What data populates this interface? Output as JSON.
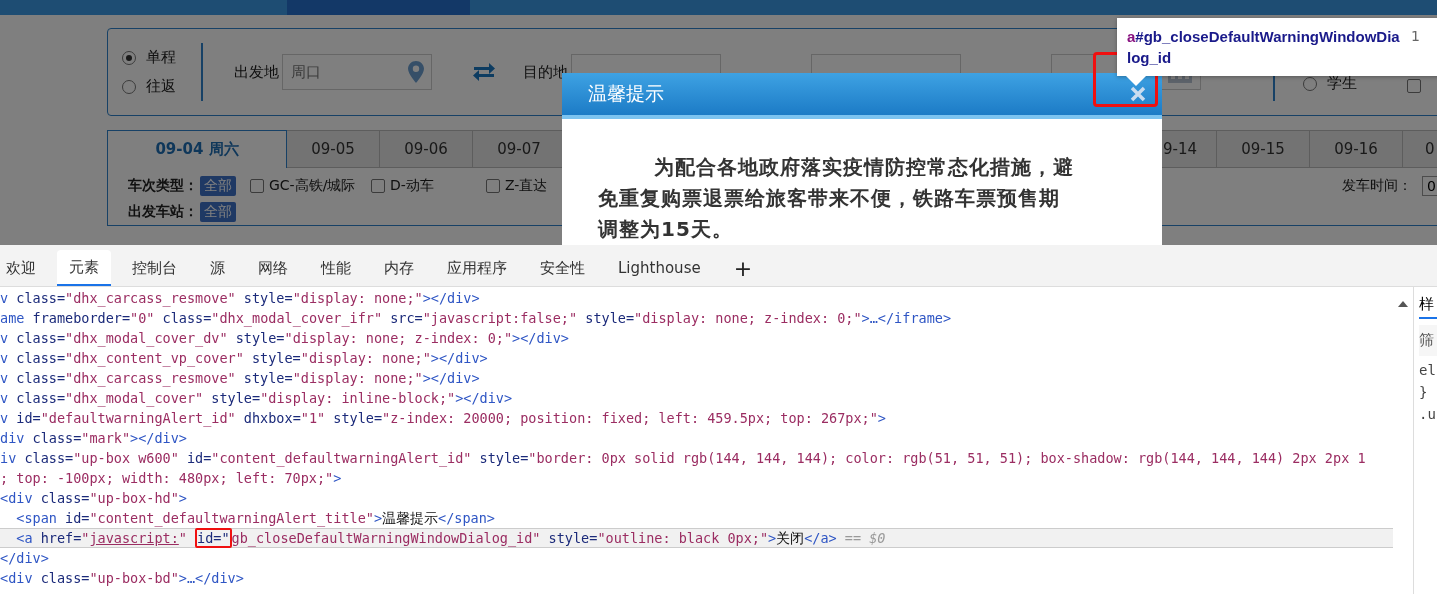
{
  "search": {
    "trip_types": [
      {
        "label": "单程",
        "selected": true
      },
      {
        "label": "往返",
        "selected": false
      }
    ],
    "fields": [
      {
        "label": "出发地",
        "value": "周口",
        "kind": "location"
      },
      {
        "label": "目的地"
      },
      {
        "kind": "plain"
      },
      {
        "kind": "date"
      }
    ],
    "passenger": {
      "label": "学生",
      "selected": false
    },
    "extra_option": {
      "checked": false
    }
  },
  "date_tabs": [
    {
      "label": "09-04 周六",
      "selected": true
    },
    {
      "label": "09-05",
      "selected": false
    },
    {
      "label": "09-06",
      "selected": false
    },
    {
      "label": "09-07",
      "selected": false
    }
  ],
  "date_tabs_right": [
    {
      "label": "9-14",
      "selected": false
    },
    {
      "label": "09-15",
      "selected": false
    },
    {
      "label": "09-16",
      "selected": false
    },
    {
      "label": "0",
      "selected": false
    }
  ],
  "filters": {
    "train_type": {
      "label": "车次类型：",
      "badge": "全部",
      "options": [
        {
          "label": "GC-高铁/城际",
          "checked": false
        },
        {
          "label": "D-动车",
          "checked": false
        },
        {
          "label": "Z-直达",
          "checked": false
        }
      ]
    },
    "station": {
      "label": "出发车站：",
      "badge": "全部"
    },
    "departure_time": {
      "label": "发车时间：",
      "value": "0"
    }
  },
  "dialog": {
    "title": "温馨提示",
    "message": "为配合各地政府落实疫情防控常态化措施，避免重复购票退票给旅客带来不便，铁路车票预售期调整为15天。"
  },
  "tooltip": {
    "tag": "a",
    "selector": "#gb_closeDefaultWarningWindowDialog_id",
    "dimension": "1"
  },
  "devtools": {
    "tabs": [
      {
        "label": "欢迎",
        "selected": false
      },
      {
        "label": "元素",
        "selected": true
      },
      {
        "label": "控制台",
        "selected": false
      },
      {
        "label": "源",
        "selected": false
      },
      {
        "label": "网络",
        "selected": false
      },
      {
        "label": "性能",
        "selected": false
      },
      {
        "label": "内存",
        "selected": false
      },
      {
        "label": "应用程序",
        "selected": false
      },
      {
        "label": "安全性",
        "selected": false
      },
      {
        "label": "Lighthouse",
        "selected": false
      }
    ],
    "add_tab": "+",
    "lines": [
      {
        "selected": false,
        "segments": [
          {
            "kind": "tag",
            "text": "v "
          },
          {
            "kind": "attr",
            "text": "class="
          },
          {
            "kind": "value",
            "text": "\"dhx_carcass_resmove\" "
          },
          {
            "kind": "attr",
            "text": "style="
          },
          {
            "kind": "value",
            "text": "\"display: none;\""
          },
          {
            "kind": "tag",
            "text": "></div>"
          }
        ]
      },
      {
        "selected": false,
        "segments": [
          {
            "kind": "tag",
            "text": "ame "
          },
          {
            "kind": "attr",
            "text": "frameborder="
          },
          {
            "kind": "value",
            "text": "\"0\" "
          },
          {
            "kind": "attr",
            "text": "class="
          },
          {
            "kind": "value",
            "text": "\"dhx_modal_cover_ifr\" "
          },
          {
            "kind": "attr",
            "text": "src="
          },
          {
            "kind": "value",
            "text": "\"javascript:false;\" "
          },
          {
            "kind": "attr",
            "text": "style="
          },
          {
            "kind": "value",
            "text": "\"display: none; z-index: 0;\""
          },
          {
            "kind": "tag",
            "text": ">…</iframe>"
          }
        ]
      },
      {
        "selected": false,
        "segments": [
          {
            "kind": "tag",
            "text": "v "
          },
          {
            "kind": "attr",
            "text": "class="
          },
          {
            "kind": "value",
            "text": "\"dhx_modal_cover_dv\" "
          },
          {
            "kind": "attr",
            "text": "style="
          },
          {
            "kind": "value",
            "text": "\"display: none; z-index: 0;\""
          },
          {
            "kind": "tag",
            "text": "></div>"
          }
        ]
      },
      {
        "selected": false,
        "segments": [
          {
            "kind": "tag",
            "text": "v "
          },
          {
            "kind": "attr",
            "text": "class="
          },
          {
            "kind": "value",
            "text": "\"dhx_content_vp_cover\" "
          },
          {
            "kind": "attr",
            "text": "style="
          },
          {
            "kind": "value",
            "text": "\"display: none;\""
          },
          {
            "kind": "tag",
            "text": "></div>"
          }
        ]
      },
      {
        "selected": false,
        "segments": [
          {
            "kind": "tag",
            "text": "v "
          },
          {
            "kind": "attr",
            "text": "class="
          },
          {
            "kind": "value",
            "text": "\"dhx_carcass_resmove\" "
          },
          {
            "kind": "attr",
            "text": "style="
          },
          {
            "kind": "value",
            "text": "\"display: none;\""
          },
          {
            "kind": "tag",
            "text": "></div>"
          }
        ]
      },
      {
        "selected": false,
        "segments": [
          {
            "kind": "tag",
            "text": "v "
          },
          {
            "kind": "attr",
            "text": "class="
          },
          {
            "kind": "value",
            "text": "\"dhx_modal_cover\" "
          },
          {
            "kind": "attr",
            "text": "style="
          },
          {
            "kind": "value",
            "text": "\"display: inline-block;\""
          },
          {
            "kind": "tag",
            "text": "></div>"
          }
        ]
      },
      {
        "selected": false,
        "segments": [
          {
            "kind": "tag",
            "text": "v "
          },
          {
            "kind": "attr",
            "text": "id="
          },
          {
            "kind": "value",
            "text": "\"defaultwarningAlert_id\" "
          },
          {
            "kind": "attr",
            "text": "dhxbox="
          },
          {
            "kind": "value",
            "text": "\"1\" "
          },
          {
            "kind": "attr",
            "text": "style="
          },
          {
            "kind": "value",
            "text": "\"z-index: 20000; position: fixed; left: 459.5px; top: 267px;\""
          },
          {
            "kind": "tag",
            "text": ">"
          }
        ]
      },
      {
        "selected": false,
        "segments": [
          {
            "kind": "tag",
            "text": "div "
          },
          {
            "kind": "attr",
            "text": "class="
          },
          {
            "kind": "value",
            "text": "\"mark\""
          },
          {
            "kind": "tag",
            "text": "></div>"
          }
        ]
      },
      {
        "selected": false,
        "segments": [
          {
            "kind": "tag",
            "text": "iv "
          },
          {
            "kind": "attr",
            "text": "class="
          },
          {
            "kind": "value",
            "text": "\"up-box w600\" "
          },
          {
            "kind": "attr",
            "text": "id="
          },
          {
            "kind": "value",
            "text": "\"content_defaultwarningAlert_id\" "
          },
          {
            "kind": "attr",
            "text": "style="
          },
          {
            "kind": "value",
            "text": "\"border: 0px solid rgb(144, 144, 144); color: rgb(51, 51, 51); box-shadow: rgb(144, 144, 144) 2px 2px 1"
          }
        ]
      },
      {
        "selected": false,
        "segments": [
          {
            "kind": "value",
            "text": "; top: -100px; width: 480px; left: 70px;\""
          },
          {
            "kind": "tag",
            "text": ">"
          }
        ]
      },
      {
        "selected": false,
        "segments": [
          {
            "kind": "tag",
            "text": "<div "
          },
          {
            "kind": "attr",
            "text": "class="
          },
          {
            "kind": "value",
            "text": "\"up-box-hd\""
          },
          {
            "kind": "tag",
            "text": ">"
          }
        ]
      },
      {
        "selected": false,
        "segments": [
          {
            "kind": "tag",
            "text": "  <span "
          },
          {
            "kind": "attr",
            "text": "id="
          },
          {
            "kind": "value",
            "text": "\"content_defaultwarningAlert_title\""
          },
          {
            "kind": "tag",
            "text": ">"
          },
          {
            "kind": "text",
            "text": "温馨提示"
          },
          {
            "kind": "tag",
            "text": "</span>"
          }
        ]
      },
      {
        "selected": true,
        "segments": [
          {
            "kind": "tag",
            "text": "  <a "
          },
          {
            "kind": "attr",
            "text": "href="
          },
          {
            "kind": "value",
            "text": "\""
          },
          {
            "kind": "link",
            "text": "javascript:"
          },
          {
            "kind": "value",
            "text": "\" "
          },
          {
            "kind": "boxed",
            "text": "id=\""
          },
          {
            "kind": "value",
            "text": "gb_closeDefaultWarningWindowDialog_id\" "
          },
          {
            "kind": "attr",
            "text": "style="
          },
          {
            "kind": "value",
            "text": "\"outline: black 0px;\""
          },
          {
            "kind": "tag",
            "text": ">"
          },
          {
            "kind": "text",
            "text": "关闭"
          },
          {
            "kind": "tag",
            "text": "</a>"
          },
          {
            "kind": "dim",
            "text": " == $0"
          }
        ]
      },
      {
        "selected": false,
        "segments": [
          {
            "kind": "tag",
            "text": "</div>"
          }
        ]
      },
      {
        "selected": false,
        "segments": [
          {
            "kind": "tag",
            "text": "<div "
          },
          {
            "kind": "attr",
            "text": "class="
          },
          {
            "kind": "value",
            "text": "\"up-box-bd\""
          },
          {
            "kind": "tag",
            "text": ">…</div>"
          }
        ]
      }
    ],
    "side_panel": {
      "tab": "样",
      "filter": "筛",
      "rules": [
        "el",
        "}",
        ".u"
      ]
    }
  }
}
